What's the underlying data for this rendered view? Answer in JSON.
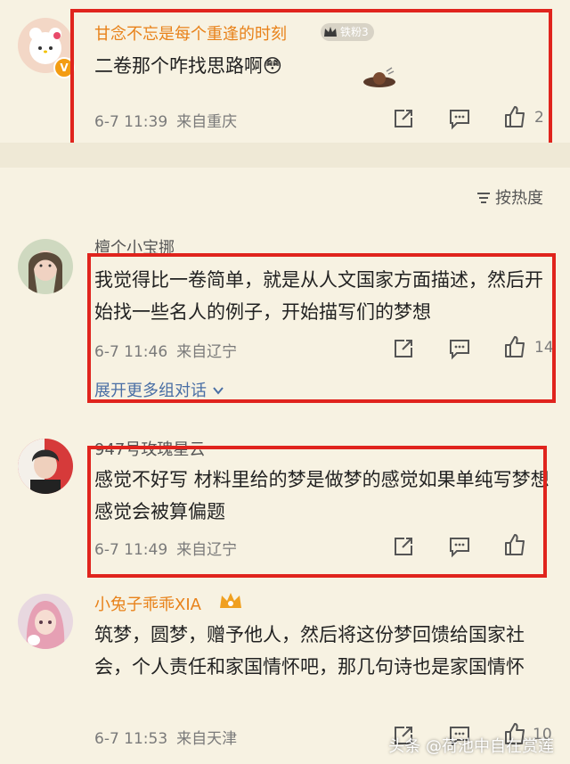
{
  "comments": [
    {
      "username": "甘念不忘是每个重逢的时刻",
      "fan_badge": "铁粉3",
      "text": "二卷那个咋找思路啊😳",
      "time": "6-7 11:39",
      "location": "来自重庆",
      "likes": "2",
      "verified": true
    },
    {
      "username": "檀个小宝挪",
      "text": "我觉得比一卷简单，就是从人文国家方面描述，然后开始找一些名人的例子，开始描写们的梦想",
      "time": "6-7 11:46",
      "location": "来自辽宁",
      "likes": "14",
      "more_replies": "展开更多组对话"
    },
    {
      "username": "947号玫瑰星云",
      "text": "感觉不好写 材料里给的梦是做梦的感觉如果单纯写梦想感觉会被算偏题",
      "time": "6-7 11:49",
      "location": "来自辽宁",
      "likes": ""
    },
    {
      "username": "小兔子乖乖XIA",
      "text": "筑梦，圆梦，赠予他人，然后将这份梦回馈给国家社会，个人责任和家国情怀吧，那几句诗也是家国情怀",
      "time": "6-7 11:53",
      "location": "来自天津",
      "likes": "10"
    }
  ],
  "sort_label": "按热度",
  "watermark": "头条 @荷池中自在赏莲",
  "icons": [
    "share-icon",
    "comment-icon",
    "like-icon",
    "sort-icon",
    "chevron-down-icon",
    "crown-badge-icon"
  ],
  "colors": {
    "highlight": "#e0241d",
    "background": "#f7f2e2",
    "username_vip": "#e8821a",
    "link": "#4a6fa5"
  }
}
